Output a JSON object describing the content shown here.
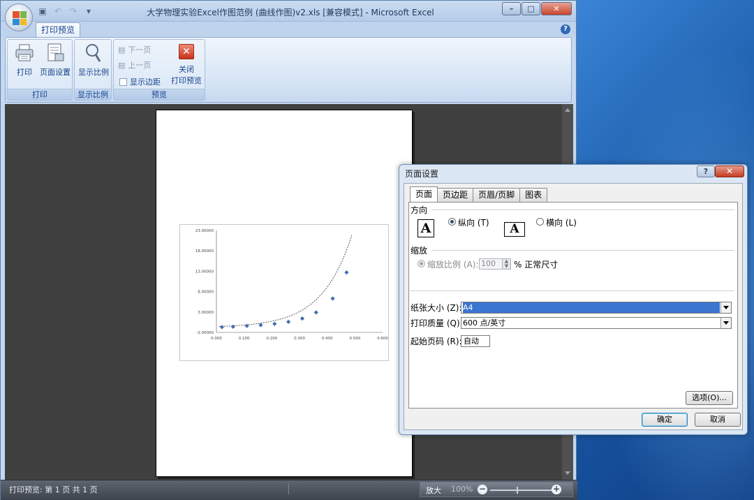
{
  "window": {
    "title": "大学物理实验Excel作图范例 (曲线作图)v2.xls [兼容模式] - Microsoft Excel",
    "tab": "打印预览"
  },
  "ribbon": {
    "groups": [
      {
        "label": "打印",
        "buttons": [
          "打印",
          "页面设置"
        ]
      },
      {
        "label": "显示比例",
        "buttons": [
          "显示比例"
        ]
      },
      {
        "label": "预览",
        "next": "下一页",
        "prev": "上一页",
        "margins": "显示边距",
        "close_l1": "关闭",
        "close_l2": "打印预览"
      }
    ]
  },
  "chart_data": {
    "type": "scatter",
    "title": "",
    "ylim": [
      -2,
      23
    ],
    "y_ticks": [
      "23.00000",
      "18.00000",
      "13.00000",
      "8.00000",
      "3.00000",
      "-2.00000"
    ],
    "x_ticks": [
      "0.000",
      "0.100",
      "0.200",
      "0.300",
      "0.400",
      "0.500",
      "0.600"
    ],
    "x": [
      0.02,
      0.06,
      0.11,
      0.16,
      0.21,
      0.26,
      0.31,
      0.36,
      0.42,
      0.47
    ],
    "values": [
      -0.7,
      -0.6,
      -0.4,
      -0.2,
      0.1,
      0.6,
      1.4,
      2.9,
      6.3,
      12.7
    ]
  },
  "dialog": {
    "title": "页面设置",
    "tabs": [
      "页面",
      "页边距",
      "页眉/页脚",
      "图表"
    ],
    "orientation_label": "方向",
    "portrait": "纵向",
    "portrait_key": "(T)",
    "landscape": "横向",
    "landscape_key": "(L)",
    "scaling_label": "缩放",
    "scale_text": "缩放比例",
    "scale_key": "(A):",
    "scale_value": "100",
    "scale_suffix": "% 正常尺寸",
    "paper_label": "纸张大小",
    "paper_key": "(Z):",
    "paper_value": "A4",
    "quality_label": "打印质量",
    "quality_key": "(Q):",
    "quality_value": "600 点/英寸",
    "first_page_label": "起始页码",
    "first_page_key": "(R):",
    "first_page_value": "自动",
    "options_button": "选项(O)...",
    "ok_button": "确定",
    "cancel_button": "取消"
  },
  "status": {
    "text": "打印预览: 第 1 页 共 1 页",
    "zoom_label": "放大",
    "zoom_value": "100%"
  }
}
